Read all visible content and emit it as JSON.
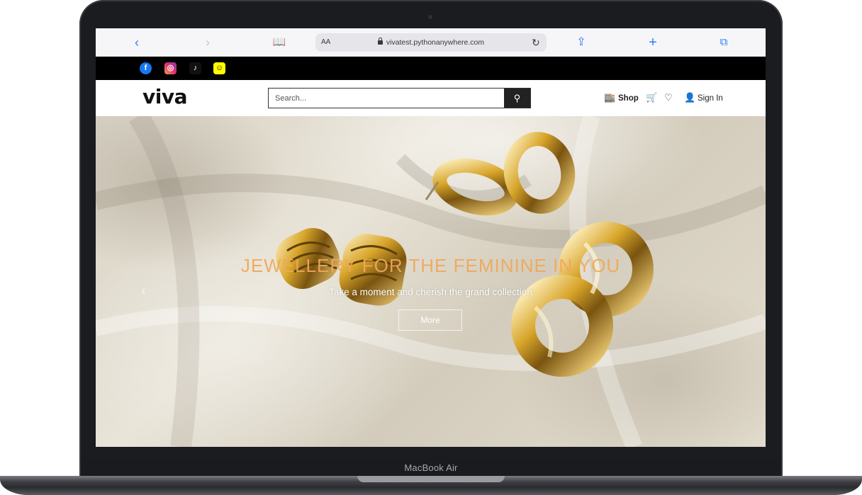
{
  "device": {
    "label": "MacBook Air"
  },
  "browser": {
    "text_size_label": "AA",
    "url": "vivatest.pythonanywhere.com",
    "icons": {
      "back": "chevron-left-icon",
      "forward": "chevron-right-icon",
      "bookmarks": "book-icon",
      "reload": "reload-icon",
      "share": "share-icon",
      "new_tab": "plus-icon",
      "tabs": "tabs-icon"
    }
  },
  "social": {
    "items": [
      {
        "name": "facebook-icon",
        "glyph": "f"
      },
      {
        "name": "instagram-icon",
        "glyph": "◎"
      },
      {
        "name": "tiktok-icon",
        "glyph": "♪"
      },
      {
        "name": "snapchat-icon",
        "glyph": "☺"
      }
    ]
  },
  "header": {
    "logo": "viva",
    "search_placeholder": "Search...",
    "shop_label": "Shop",
    "sign_in_label": "Sign In"
  },
  "hero": {
    "title": "JEWELLERY FOR THE FEMININE IN YOU",
    "subtitle": "Take a moment and cherish the grand collection",
    "button_label": "More"
  },
  "colors": {
    "hero_title": "#f0a85a",
    "browser_accent": "#2f7cf6",
    "social_bar": "#000000"
  }
}
